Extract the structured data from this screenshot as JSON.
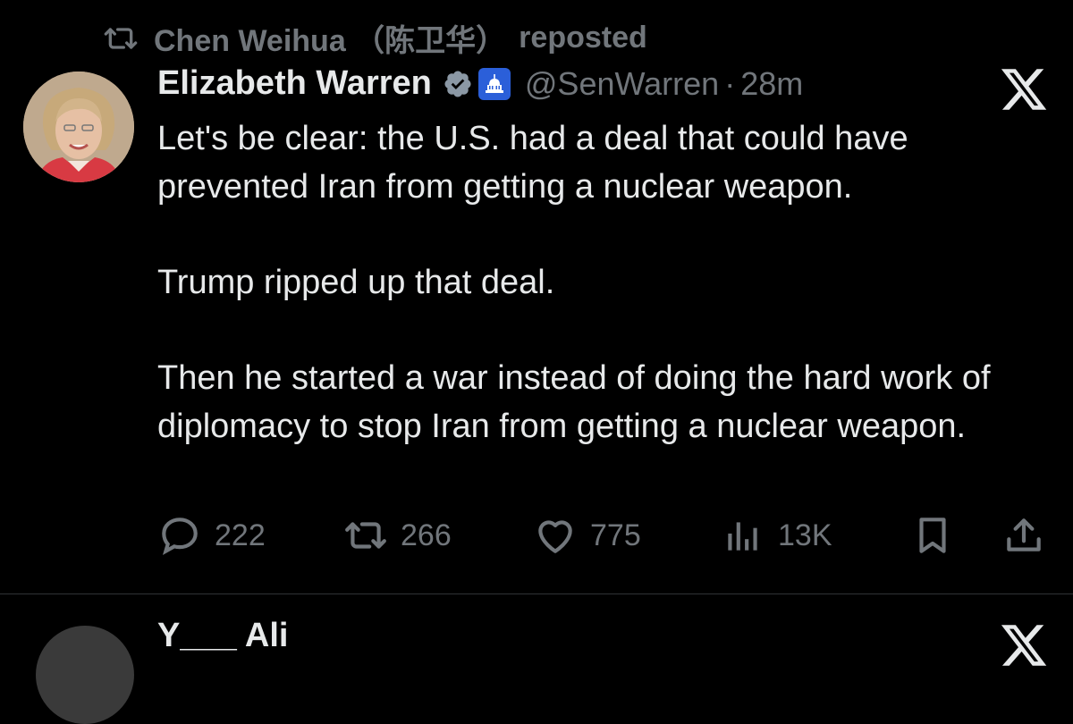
{
  "repost": {
    "reposter": "Chen Weihua （陈卫华）",
    "label": "reposted"
  },
  "tweet": {
    "author_name": "Elizabeth Warren",
    "handle": "@SenWarren",
    "separator": "·",
    "time": "28m",
    "paragraphs": [
      "Let's be clear: the U.S. had a deal that could have prevented Iran from getting a nuclear weapon.",
      "Trump ripped up that deal.",
      "Then he started a war instead of doing the hard work of diplomacy to stop Iran from getting a nuclear weapon."
    ]
  },
  "actions": {
    "replies": "222",
    "reposts": "266",
    "likes": "775",
    "views": "13K"
  },
  "next_tweet": {
    "author_partial": "Y___ Ali"
  },
  "colors": {
    "background": "#000000",
    "text": "#e7e9ea",
    "muted": "#71767b",
    "verified": "#8b98a5",
    "divider": "#2f3336"
  },
  "icons": [
    "repost-icon",
    "verified-badge-icon",
    "capitol-affiliation-icon",
    "x-logo-icon",
    "reply-icon",
    "like-icon",
    "views-icon",
    "bookmark-icon",
    "share-icon"
  ]
}
